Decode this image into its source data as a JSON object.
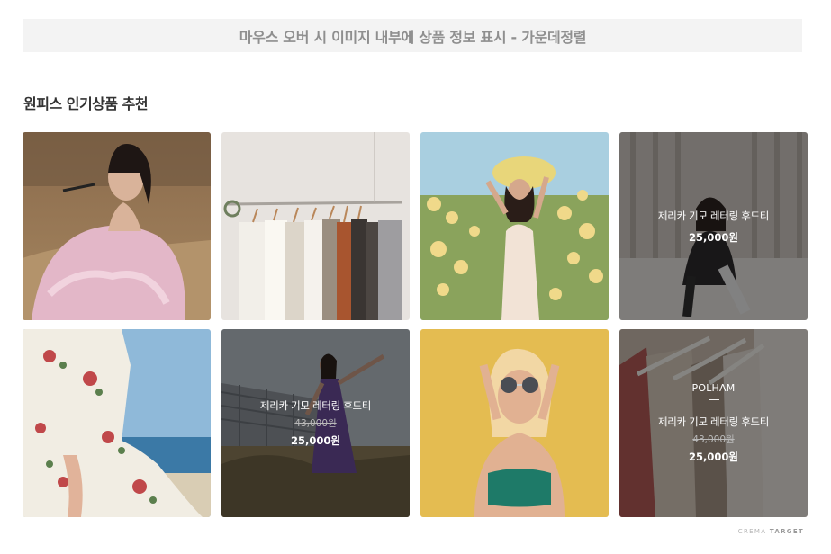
{
  "banner": {
    "text": "마우스 오버 시 이미지 내부에 상품 정보 표시 - 가운데정렬"
  },
  "section": {
    "title": "원피스 인기상품 추천"
  },
  "products": [
    {
      "icon": "photo-woman-pink-dress",
      "hover": false
    },
    {
      "icon": "photo-clothes-rack",
      "hover": false
    },
    {
      "icon": "photo-woman-flower-field",
      "hover": false
    },
    {
      "icon": "photo-woman-sitting",
      "hover": true,
      "name": "제리카 기모 레터링 후드티",
      "price": "25,000원"
    },
    {
      "icon": "photo-floral-wrap-dress",
      "hover": false
    },
    {
      "icon": "photo-woman-purple-dress",
      "hover": true,
      "name": "제리카 기모 레터링 후드티",
      "original_price": "43,000원",
      "price": "25,000원"
    },
    {
      "icon": "photo-woman-sunglasses",
      "hover": false
    },
    {
      "icon": "photo-hanging-garments",
      "hover": true,
      "brand": "POLHAM",
      "name": "제리카 기모 레터링 후드티",
      "original_price": "43,000원",
      "price": "25,000원"
    }
  ],
  "footer": {
    "logo_light": "CREMA",
    "logo_bold": "TARGET"
  }
}
